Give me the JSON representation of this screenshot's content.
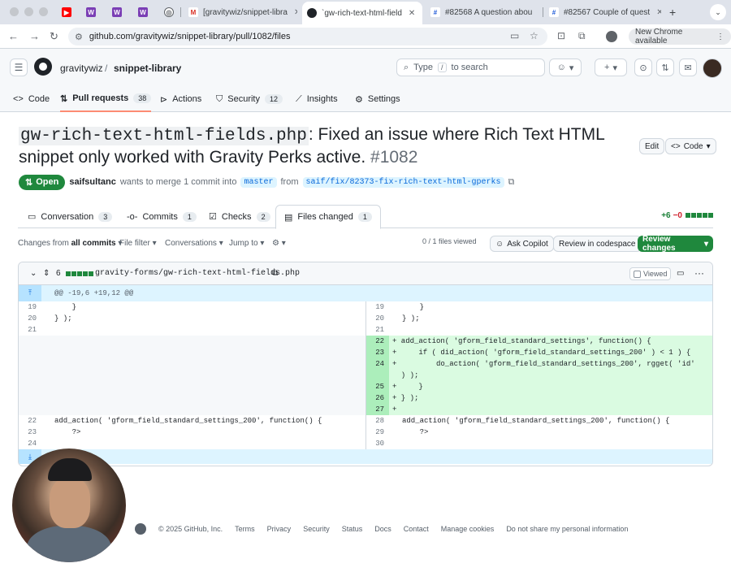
{
  "browser": {
    "tabs": [
      {
        "title": "",
        "icon": "youtube-icon",
        "color": "#ff0000"
      },
      {
        "title": "",
        "icon": "wordpress-icon",
        "color": "#7b3fb5"
      },
      {
        "title": "",
        "icon": "wordpress-icon",
        "color": "#7b3fb5"
      },
      {
        "title": "",
        "icon": "wordpress-icon",
        "color": "#7b3fb5"
      },
      {
        "title": "",
        "icon": "globe-icon",
        "color": "#5f6368"
      },
      {
        "title": "[gravitywiz/snippet-libra",
        "icon": "gmail-icon",
        "color": "#d93025"
      },
      {
        "title": "`gw-rich-text-html-field",
        "icon": "github-icon",
        "color": "#1f2328"
      },
      {
        "title": "#82568 A question abou",
        "icon": "helpscout-icon",
        "color": "#1f5ad8"
      },
      {
        "title": "#82567 Couple of quest",
        "icon": "helpscout-icon",
        "color": "#1f5ad8"
      }
    ],
    "url": "github.com/gravitywiz/snippet-library/pull/1082/files",
    "new_chrome_label": "New Chrome available"
  },
  "header": {
    "owner": "gravitywiz",
    "separator": "/",
    "repo": "snippet-library",
    "search_placeholder_pre": "Type",
    "search_key": "/",
    "search_placeholder_post": "to search"
  },
  "repo_nav": [
    {
      "label": "Code",
      "icon": "code-icon",
      "count": ""
    },
    {
      "label": "Pull requests",
      "icon": "pull-request-icon",
      "count": "38"
    },
    {
      "label": "Actions",
      "icon": "play-icon",
      "count": ""
    },
    {
      "label": "Security",
      "icon": "shield-icon",
      "count": "12"
    },
    {
      "label": "Insights",
      "icon": "graph-icon",
      "count": ""
    },
    {
      "label": "Settings",
      "icon": "gear-icon",
      "count": ""
    }
  ],
  "pr": {
    "title_code": "gw-rich-text-html-fields.php",
    "title_text": ": Fixed an issue where Rich Text HTML snippet only worked with Gravity Perks active.",
    "number": "#1082",
    "edit_label": "Edit",
    "code_label": "Code",
    "state": "Open",
    "author": "saifsultanc",
    "merge_text": "wants to merge 1 commit into",
    "base_branch": "master",
    "from_text": "from",
    "head_branch": "saif/fix/82373-fix-rich-text-html-gperks"
  },
  "pr_tabs": [
    {
      "label": "Conversation",
      "count": "3",
      "icon": "comment-icon"
    },
    {
      "label": "Commits",
      "count": "1",
      "icon": "commit-icon"
    },
    {
      "label": "Checks",
      "count": "2",
      "icon": "checklist-icon"
    },
    {
      "label": "Files changed",
      "count": "1",
      "icon": "file-diff-icon"
    }
  ],
  "diffstat": {
    "additions": "+6",
    "deletions": "−0"
  },
  "toolbar": {
    "changes_from_pre": "Changes from",
    "changes_from_val": "all commits",
    "file_filter": "File filter",
    "conversations": "Conversations",
    "jump_to": "Jump to",
    "files_viewed": "0 / 1 files viewed",
    "ask_copilot": "Ask Copilot",
    "review_codespace": "Review in codespace",
    "review_changes": "Review changes"
  },
  "file": {
    "change_count": "6",
    "path": "gravity-forms/gw-rich-text-html-fields.php",
    "viewed_label": "Viewed",
    "hunk_header": "@@ -19,6 +19,12 @@"
  },
  "diff_rows": [
    {
      "l_num": "19",
      "l_code": "    }",
      "r_num": "19",
      "r_code": "    }",
      "type": "ctx"
    },
    {
      "l_num": "20",
      "l_code": "} );",
      "r_num": "20",
      "r_code": "} );",
      "type": "ctx"
    },
    {
      "l_num": "21",
      "l_code": "",
      "r_num": "21",
      "r_code": "",
      "type": "ctx"
    },
    {
      "l_num": "",
      "l_code": "",
      "r_num": "22",
      "r_code": "+ add_action( 'gform_field_standard_settings', function() {",
      "type": "add"
    },
    {
      "l_num": "",
      "l_code": "",
      "r_num": "23",
      "r_code": "+     if ( did_action( 'gform_field_standard_settings_200' ) < 1 ) {",
      "type": "add"
    },
    {
      "l_num": "",
      "l_code": "",
      "r_num": "24",
      "r_code": "+         do_action( 'gform_field_standard_settings_200', rgget( 'id'",
      "type": "add"
    },
    {
      "l_num": "",
      "l_code": "",
      "r_num": "",
      "r_code": "  ) );",
      "type": "add"
    },
    {
      "l_num": "",
      "l_code": "",
      "r_num": "25",
      "r_code": "+     }",
      "type": "add"
    },
    {
      "l_num": "",
      "l_code": "",
      "r_num": "26",
      "r_code": "+ } );",
      "type": "add"
    },
    {
      "l_num": "",
      "l_code": "",
      "r_num": "27",
      "r_code": "+",
      "type": "add"
    },
    {
      "l_num": "22",
      "l_code": "add_action( 'gform_field_standard_settings_200', function() {",
      "r_num": "28",
      "r_code": "add_action( 'gform_field_standard_settings_200', function() {",
      "type": "ctx"
    },
    {
      "l_num": "23",
      "l_code": "    ?>",
      "r_num": "29",
      "r_code": "    ?>",
      "type": "ctx"
    },
    {
      "l_num": "24",
      "l_code": "",
      "r_num": "30",
      "r_code": "",
      "type": "ctx"
    }
  ],
  "footer": {
    "copyright": "© 2025 GitHub, Inc.",
    "links": [
      "Terms",
      "Privacy",
      "Security",
      "Status",
      "Docs",
      "Contact",
      "Manage cookies",
      "Do not share my personal information"
    ]
  },
  "colors": {
    "accent_green": "#1f883d",
    "link_blue": "#0969da",
    "tab_underline": "#fd8c73"
  }
}
